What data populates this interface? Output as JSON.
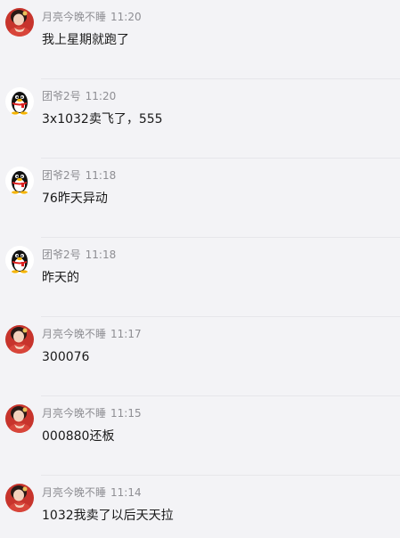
{
  "messages": [
    {
      "sender": "月亮今晚不睡",
      "time": "11:20",
      "text": "我上星期就跑了",
      "avatar": "girl-avatar-red"
    },
    {
      "sender": "团爷2号",
      "time": "11:20",
      "text": "3x1032卖飞了，555",
      "avatar": "qq-penguin-avatar"
    },
    {
      "sender": "团爷2号",
      "time": "11:18",
      "text": "76昨天异动",
      "avatar": "qq-penguin-avatar"
    },
    {
      "sender": "团爷2号",
      "time": "11:18",
      "text": "昨天的",
      "avatar": "qq-penguin-avatar"
    },
    {
      "sender": "月亮今晚不睡",
      "time": "11:17",
      "text": "300076",
      "avatar": "girl-avatar-red"
    },
    {
      "sender": "月亮今晚不睡",
      "time": "11:15",
      "text": "000880还板",
      "avatar": "girl-avatar-red"
    },
    {
      "sender": "月亮今晚不睡",
      "time": "11:14",
      "text": "1032我卖了以后天天拉",
      "avatar": "girl-avatar-red"
    }
  ],
  "colors": {
    "background": "#f3f3f6",
    "meta_text": "#8e8e93",
    "message_text": "#1a1a1a",
    "divider": "#e6e6ea"
  }
}
